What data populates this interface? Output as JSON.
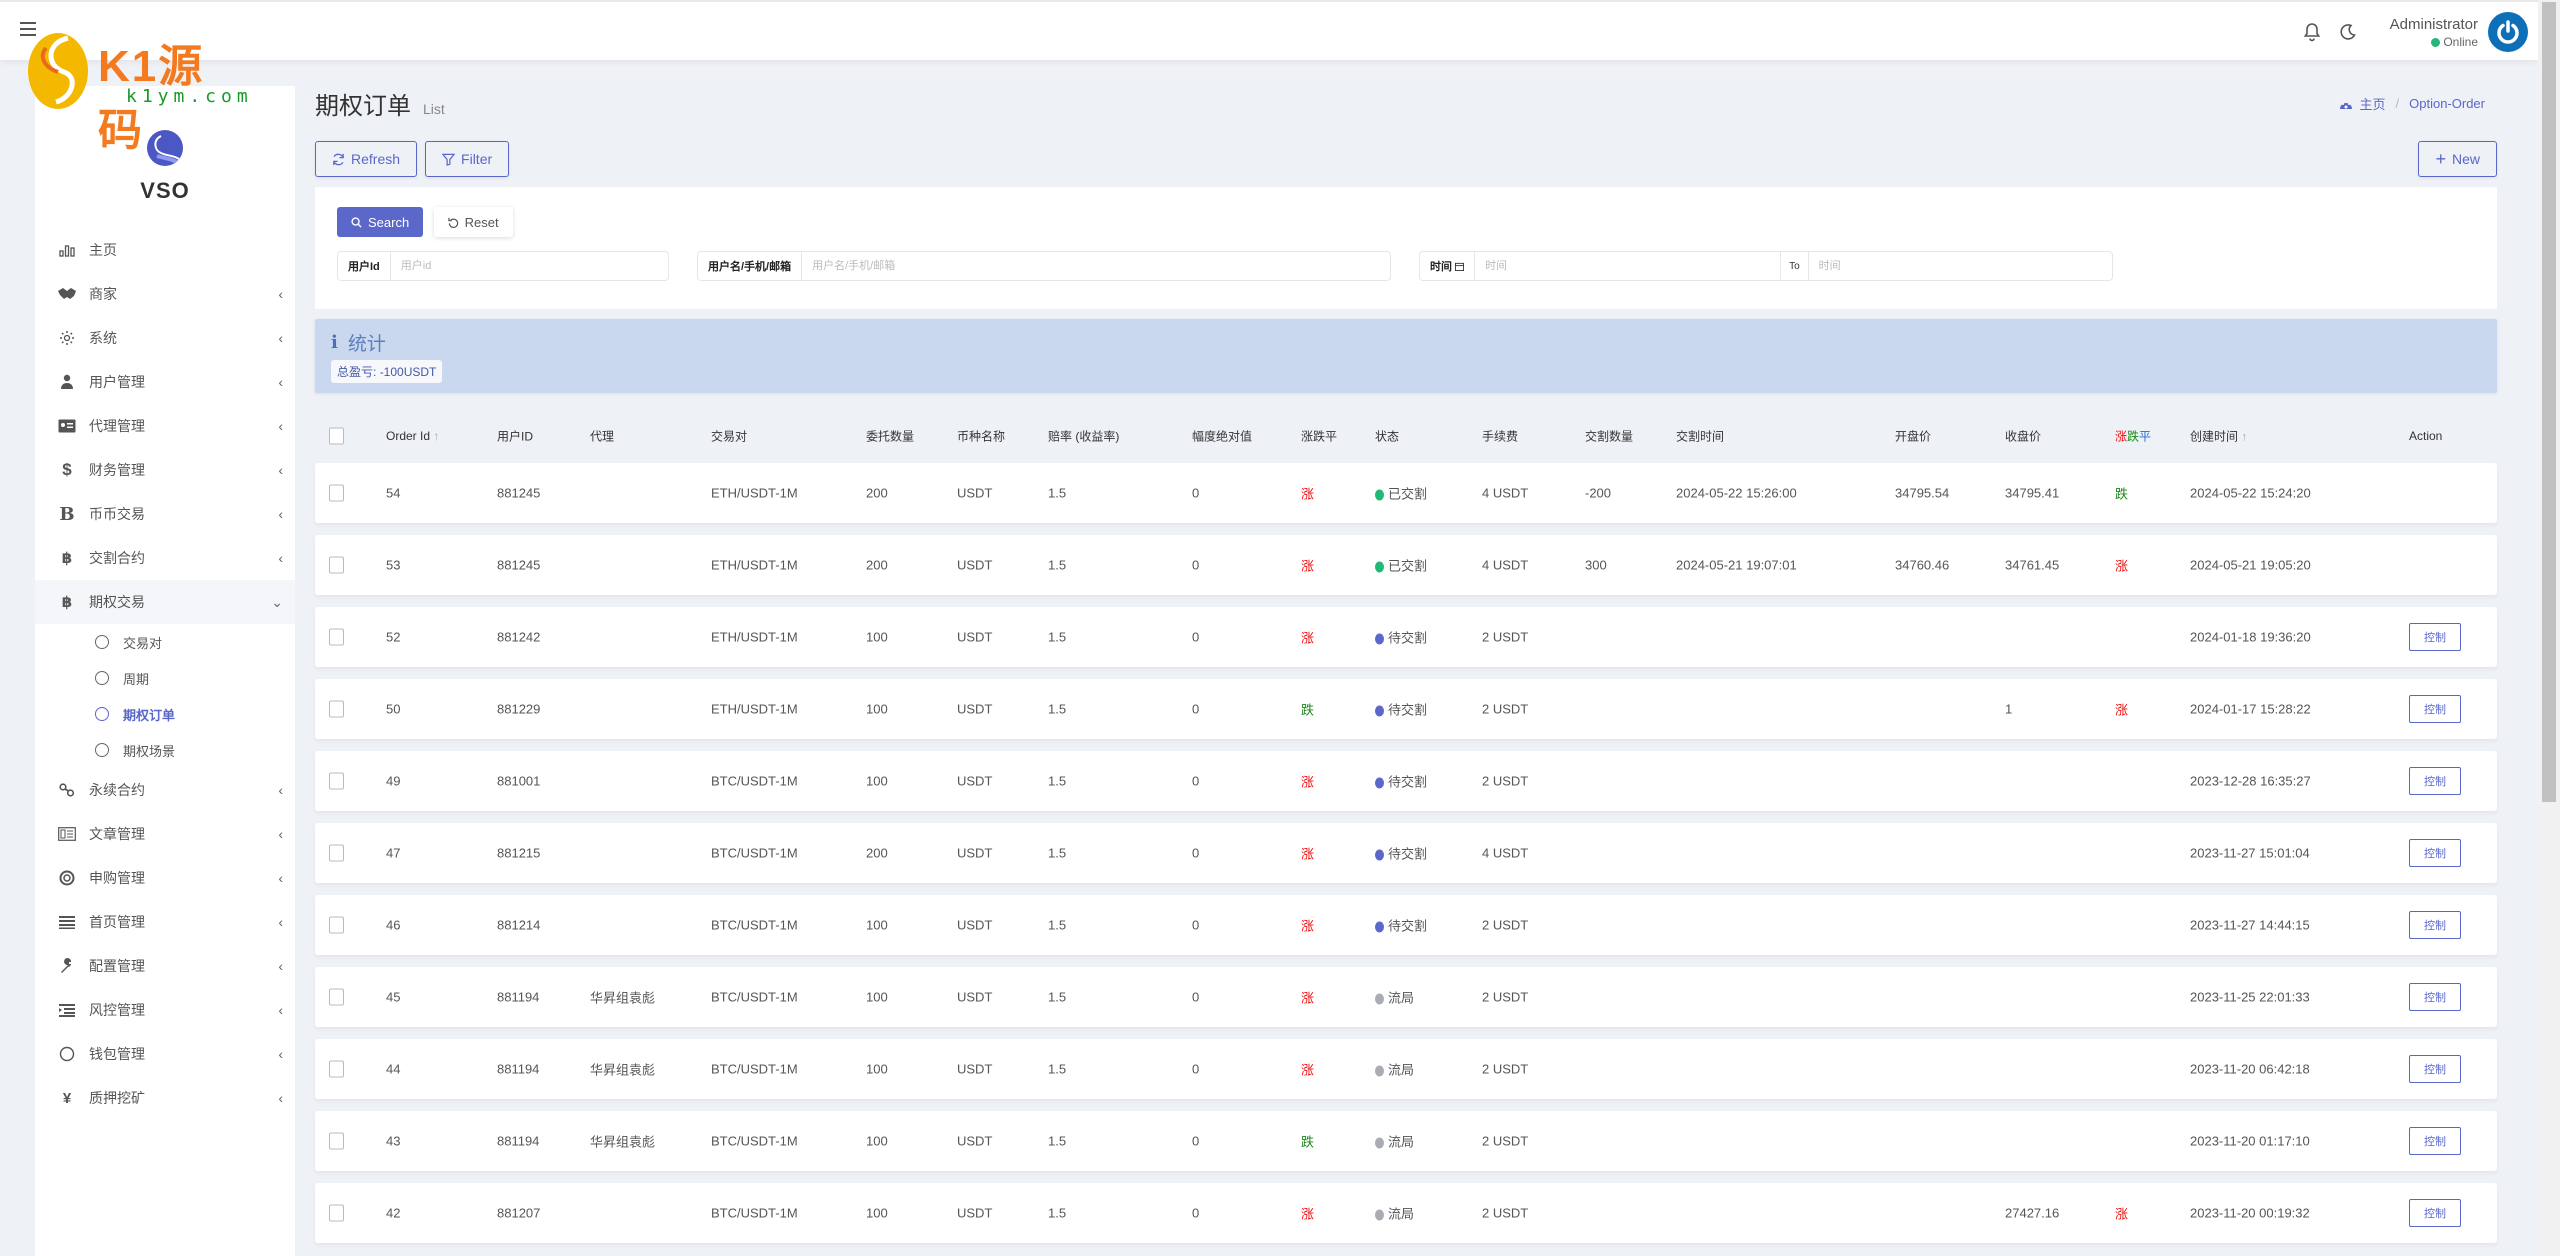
{
  "header": {
    "user_name": "Administrator",
    "user_status": "Online"
  },
  "watermark": {
    "brand": "K1源码",
    "domain": "k1ym.com"
  },
  "sidebar": {
    "brand": "VSO",
    "items": [
      {
        "label": "主页",
        "icon": "bar-chart-icon",
        "chevron": false
      },
      {
        "label": "商家",
        "icon": "handshake-icon",
        "chevron": true
      },
      {
        "label": "系统",
        "icon": "gear-icon",
        "chevron": true
      },
      {
        "label": "用户管理",
        "icon": "user-tie-icon",
        "chevron": true
      },
      {
        "label": "代理管理",
        "icon": "id-card-icon",
        "chevron": true
      },
      {
        "label": "财务管理",
        "icon": "dollar-icon",
        "chevron": true
      },
      {
        "label": "币币交易",
        "icon": "b-letter-icon",
        "chevron": true
      },
      {
        "label": "交割合约",
        "icon": "bitcoin-icon",
        "chevron": true
      },
      {
        "label": "期权交易",
        "icon": "bitcoin-icon",
        "chevron": true,
        "open": true
      }
    ],
    "sub_items": [
      {
        "label": "交易对",
        "active": false
      },
      {
        "label": "周期",
        "active": false
      },
      {
        "label": "期权订单",
        "active": true
      },
      {
        "label": "期权场景",
        "active": false
      }
    ],
    "items_after": [
      {
        "label": "永续合约",
        "icon": "link-icon"
      },
      {
        "label": "文章管理",
        "icon": "newspaper-icon"
      },
      {
        "label": "申购管理",
        "icon": "life-ring-icon"
      },
      {
        "label": "首页管理",
        "icon": "list-icon"
      },
      {
        "label": "配置管理",
        "icon": "wrench-icon"
      },
      {
        "label": "风控管理",
        "icon": "indent-icon"
      },
      {
        "label": "钱包管理",
        "icon": "circle-icon"
      },
      {
        "label": "质押挖矿",
        "icon": "yen-icon"
      }
    ]
  },
  "page": {
    "title": "期权订单",
    "subtitle": "List",
    "breadcrumb_home": "主页",
    "breadcrumb_current": "Option-Order"
  },
  "toolbar": {
    "refresh_label": "Refresh",
    "filter_label": "Filter",
    "new_label": "New"
  },
  "filter": {
    "search_label": "Search",
    "reset_label": "Reset",
    "user_id_label": "用户Id",
    "user_id_placeholder": "用户id",
    "user_id_value": "",
    "account_label": "用户名/手机/邮箱",
    "account_placeholder": "用户名/手机/邮箱",
    "account_value": "",
    "time_label": "时间",
    "time_from_placeholder": "时间",
    "time_to_label": "To",
    "time_to_placeholder": "时间"
  },
  "stats": {
    "title": "统计",
    "total_pnl_label": "总盈亏:",
    "total_pnl_value": "-100USDT"
  },
  "table": {
    "columns": {
      "order_id": "Order Id",
      "user_id": "用户ID",
      "agent": "代理",
      "pair": "交易对",
      "amount": "委托数量",
      "currency": "币种名称",
      "odds": "赔率 (收益率)",
      "range": "幅度绝对值",
      "direction": "涨跌平",
      "status": "状态",
      "fee": "手续费",
      "settle_qty": "交割数量",
      "settle_time": "交割时间",
      "open_price": "开盘价",
      "close_price": "收盘价",
      "result_up": "涨",
      "result_down": "跌",
      "result_flat": "平",
      "created_at": "创建时间",
      "action": "Action"
    },
    "status_colors": {
      "已交割": "#21b978",
      "待交割": "#5b68c9",
      "流局": "#a9adb3"
    },
    "action_label": "控制",
    "rows": [
      {
        "id": "54",
        "user": "881245",
        "agent": "",
        "pair": "ETH/USDT-1M",
        "amount": "200",
        "currency": "USDT",
        "odds": "1.5",
        "range": "0",
        "dir": "涨",
        "status": "已交割",
        "fee": "4 USDT",
        "qty": "-200",
        "settle_time": "2024-05-22 15:26:00",
        "open": "34795.54",
        "close": "34795.41",
        "result": "跌",
        "created": "2024-05-22 15:24:20",
        "action": false
      },
      {
        "id": "53",
        "user": "881245",
        "agent": "",
        "pair": "ETH/USDT-1M",
        "amount": "200",
        "currency": "USDT",
        "odds": "1.5",
        "range": "0",
        "dir": "涨",
        "status": "已交割",
        "fee": "4 USDT",
        "qty": "300",
        "settle_time": "2024-05-21 19:07:01",
        "open": "34760.46",
        "close": "34761.45",
        "result": "涨",
        "created": "2024-05-21 19:05:20",
        "action": false
      },
      {
        "id": "52",
        "user": "881242",
        "agent": "",
        "pair": "ETH/USDT-1M",
        "amount": "100",
        "currency": "USDT",
        "odds": "1.5",
        "range": "0",
        "dir": "涨",
        "status": "待交割",
        "fee": "2 USDT",
        "qty": "",
        "settle_time": "",
        "open": "",
        "close": "",
        "result": "",
        "created": "2024-01-18 19:36:20",
        "action": true
      },
      {
        "id": "50",
        "user": "881229",
        "agent": "",
        "pair": "ETH/USDT-1M",
        "amount": "100",
        "currency": "USDT",
        "odds": "1.5",
        "range": "0",
        "dir": "跌",
        "status": "待交割",
        "fee": "2 USDT",
        "qty": "",
        "settle_time": "",
        "open": "",
        "close": "1",
        "result": "涨",
        "created": "2024-01-17 15:28:22",
        "action": true
      },
      {
        "id": "49",
        "user": "881001",
        "agent": "",
        "pair": "BTC/USDT-1M",
        "amount": "100",
        "currency": "USDT",
        "odds": "1.5",
        "range": "0",
        "dir": "涨",
        "status": "待交割",
        "fee": "2 USDT",
        "qty": "",
        "settle_time": "",
        "open": "",
        "close": "",
        "result": "",
        "created": "2023-12-28 16:35:27",
        "action": true
      },
      {
        "id": "47",
        "user": "881215",
        "agent": "",
        "pair": "BTC/USDT-1M",
        "amount": "200",
        "currency": "USDT",
        "odds": "1.5",
        "range": "0",
        "dir": "涨",
        "status": "待交割",
        "fee": "4 USDT",
        "qty": "",
        "settle_time": "",
        "open": "",
        "close": "",
        "result": "",
        "created": "2023-11-27 15:01:04",
        "action": true
      },
      {
        "id": "46",
        "user": "881214",
        "agent": "",
        "pair": "BTC/USDT-1M",
        "amount": "100",
        "currency": "USDT",
        "odds": "1.5",
        "range": "0",
        "dir": "涨",
        "status": "待交割",
        "fee": "2 USDT",
        "qty": "",
        "settle_time": "",
        "open": "",
        "close": "",
        "result": "",
        "created": "2023-11-27 14:44:15",
        "action": true
      },
      {
        "id": "45",
        "user": "881194",
        "agent": "华昇组袁彪",
        "pair": "BTC/USDT-1M",
        "amount": "100",
        "currency": "USDT",
        "odds": "1.5",
        "range": "0",
        "dir": "涨",
        "status": "流局",
        "fee": "2 USDT",
        "qty": "",
        "settle_time": "",
        "open": "",
        "close": "",
        "result": "",
        "created": "2023-11-25 22:01:33",
        "action": true
      },
      {
        "id": "44",
        "user": "881194",
        "agent": "华昇组袁彪",
        "pair": "BTC/USDT-1M",
        "amount": "100",
        "currency": "USDT",
        "odds": "1.5",
        "range": "0",
        "dir": "涨",
        "status": "流局",
        "fee": "2 USDT",
        "qty": "",
        "settle_time": "",
        "open": "",
        "close": "",
        "result": "",
        "created": "2023-11-20 06:42:18",
        "action": true
      },
      {
        "id": "43",
        "user": "881194",
        "agent": "华昇组袁彪",
        "pair": "BTC/USDT-1M",
        "amount": "100",
        "currency": "USDT",
        "odds": "1.5",
        "range": "0",
        "dir": "跌",
        "status": "流局",
        "fee": "2 USDT",
        "qty": "",
        "settle_time": "",
        "open": "",
        "close": "",
        "result": "",
        "created": "2023-11-20 01:17:10",
        "action": true
      },
      {
        "id": "42",
        "user": "881207",
        "agent": "",
        "pair": "BTC/USDT-1M",
        "amount": "100",
        "currency": "USDT",
        "odds": "1.5",
        "range": "0",
        "dir": "涨",
        "status": "流局",
        "fee": "2 USDT",
        "qty": "",
        "settle_time": "",
        "open": "",
        "close": "27427.16",
        "result": "涨",
        "created": "2023-11-20 00:19:32",
        "action": true
      }
    ]
  }
}
